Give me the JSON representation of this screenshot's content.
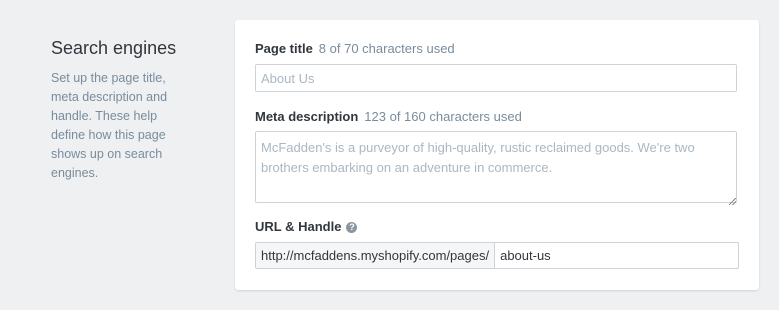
{
  "section": {
    "heading": "Search engines",
    "description": "Set up the page title, meta description and handle. These help define how this page shows up on search engines."
  },
  "page_title": {
    "label": "Page title",
    "count": "8 of 70 characters used",
    "placeholder": "About Us"
  },
  "meta_description": {
    "label": "Meta description",
    "count": "123 of 160 characters used",
    "placeholder": "McFadden's is a purveyor of high-quality, rustic reclaimed goods. We're two brothers embarking on an adventure in commerce."
  },
  "url_handle": {
    "label": "URL & Handle",
    "help_icon": "question-circle-icon",
    "help_glyph": "?",
    "prefix": "http://mcfaddens.myshopify.com/pages/",
    "value": "about-us"
  }
}
